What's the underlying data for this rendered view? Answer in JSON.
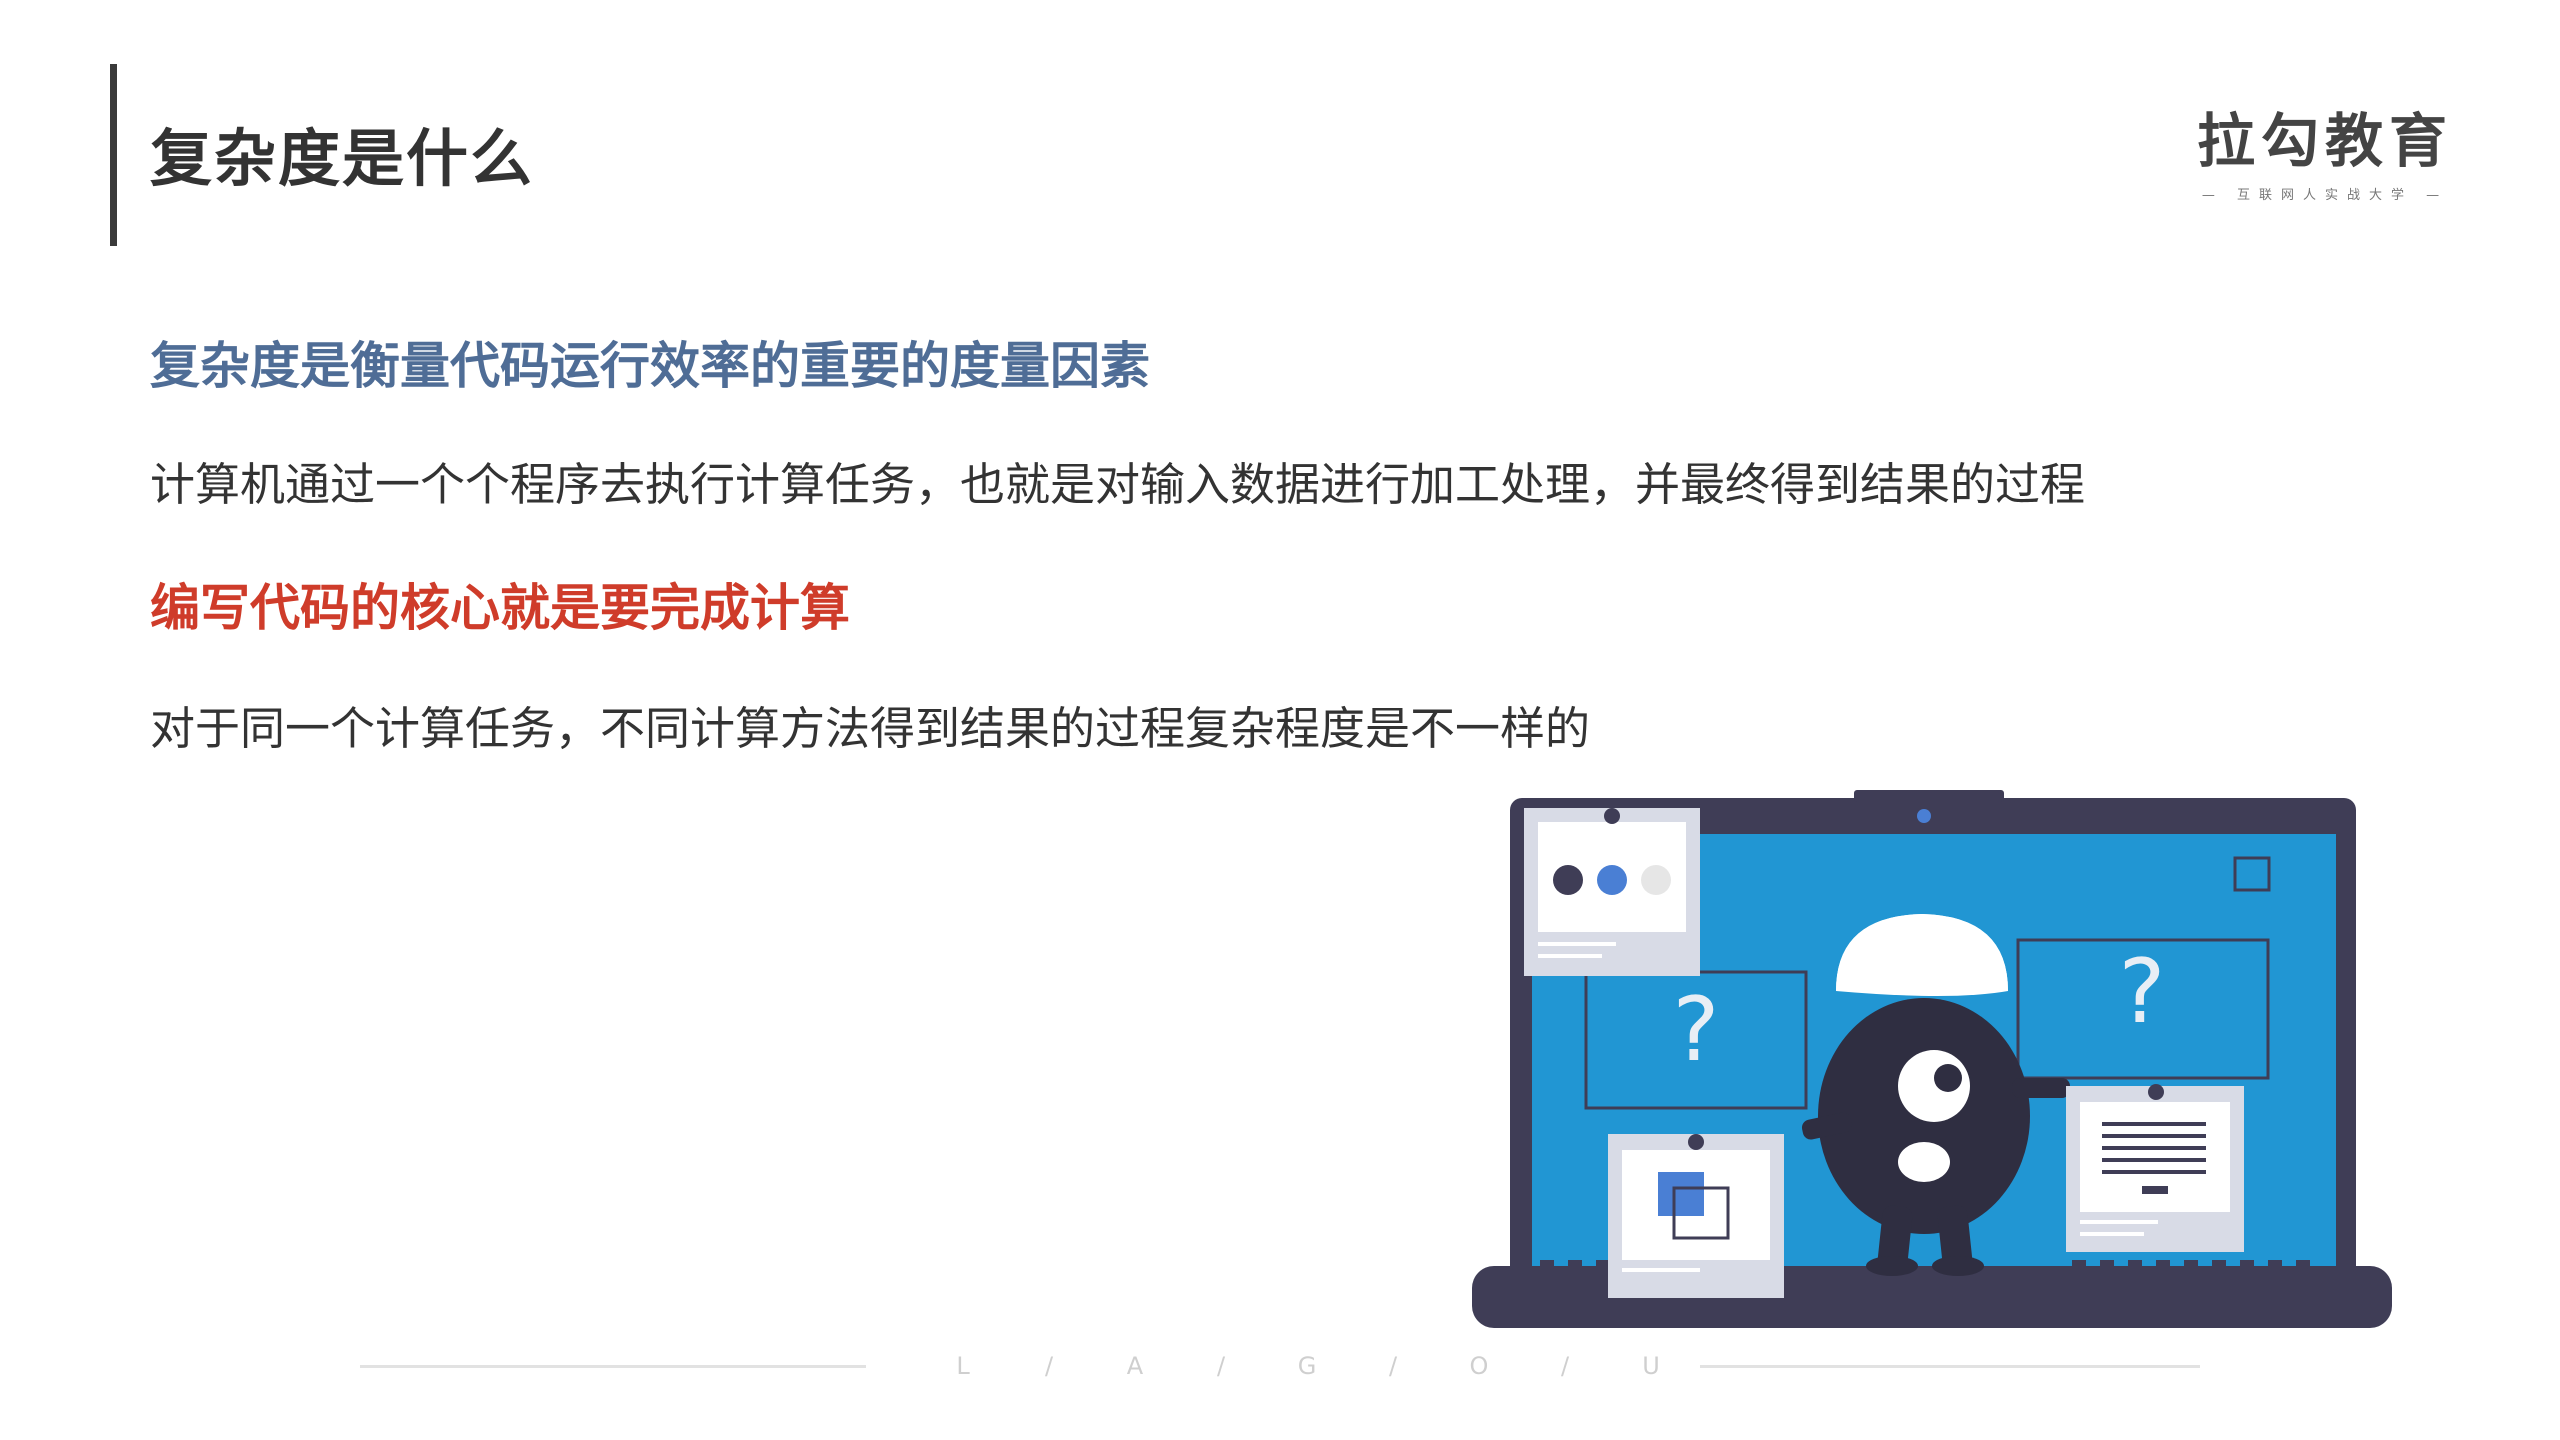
{
  "slide": {
    "title": "复杂度是什么"
  },
  "logo": {
    "main": "拉勾教育",
    "sub": "— 互联网人实战大学 —"
  },
  "content": {
    "line1": "复杂度是衡量代码运行效率的重要的度量因素",
    "line2": "计算机通过一个个程序去执行计算任务，也就是对输入数据进行加工处理，并最终得到结果的过程",
    "line3": "编写代码的核心就是要完成计算",
    "line4": "对于同一个计算任务，不同计算方法得到结果的过程复杂程度是不一样的"
  },
  "illustration": {
    "question_mark": "?"
  },
  "footer": {
    "letters": [
      "L",
      "/",
      "A",
      "/",
      "G",
      "/",
      "O",
      "/",
      "U"
    ]
  },
  "colors": {
    "heading_blue": "#4f6d96",
    "heading_red": "#cf3c2a",
    "screen_blue": "#2196d3",
    "laptop_dark": "#3f3d56"
  }
}
